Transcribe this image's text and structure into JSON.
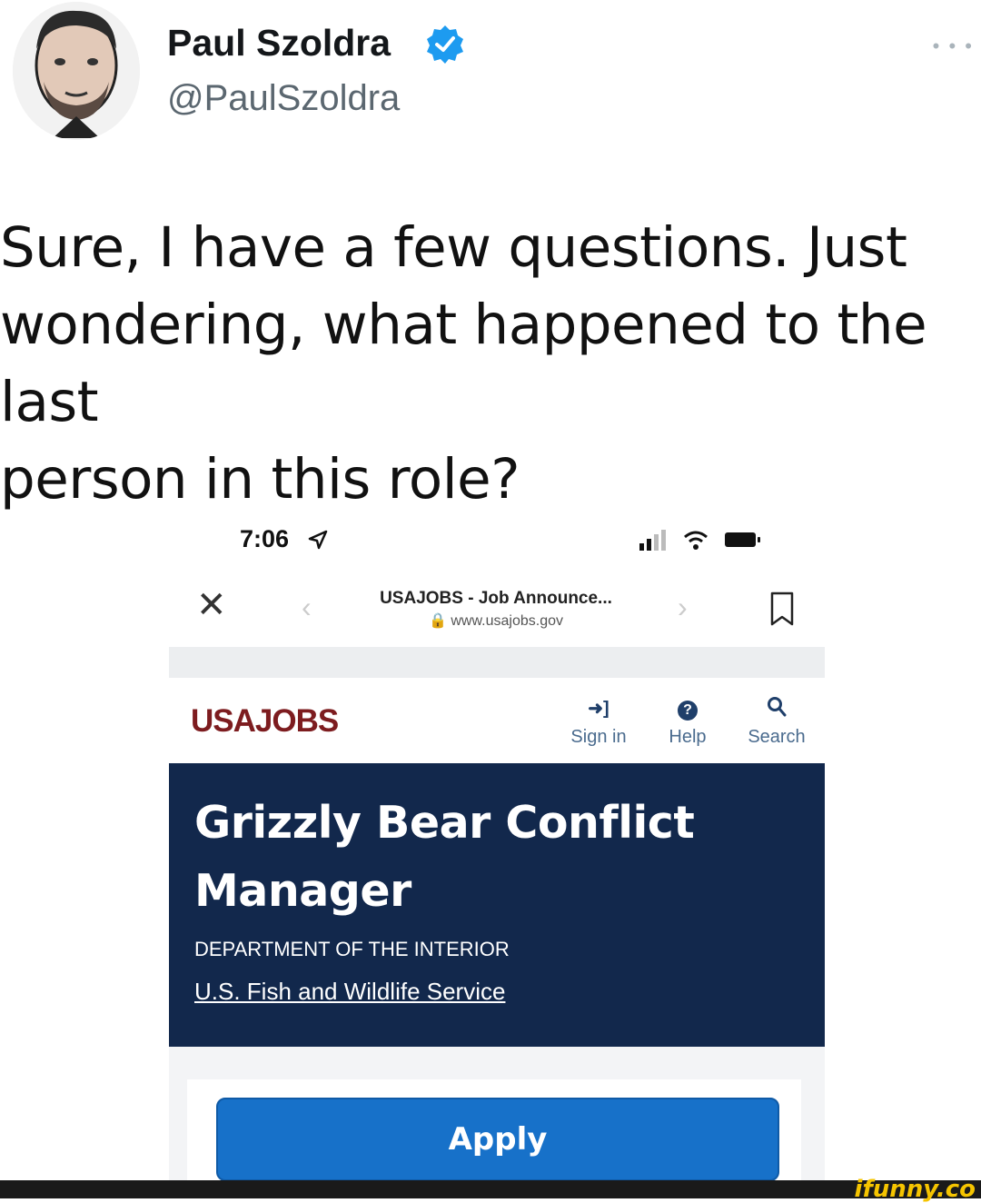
{
  "tweet": {
    "author_name": "Paul Szoldra",
    "handle": "@PaulSzoldra",
    "verified_icon": "verified-badge-icon",
    "more_icon": "more-options-icon",
    "text": "Sure, I have a few questions. Just\nwondering, what happened to the last\nperson in this role?"
  },
  "phone": {
    "status_time": "7:06",
    "location_icon": "location-arrow-icon",
    "status_icons": [
      "cellular-signal-icon",
      "wifi-icon",
      "battery-icon"
    ]
  },
  "browser": {
    "close_icon": "close-icon",
    "back_icon": "chevron-left-icon",
    "forward_icon": "chevron-right-icon",
    "page_title": "USAJOBS - Job Announce...",
    "url": "🔒 www.usajobs.gov",
    "bookmark_icon": "bookmark-icon"
  },
  "site": {
    "logo": "USAJOBS",
    "nav": [
      {
        "icon": "➜]",
        "label": "Sign in"
      },
      {
        "icon": "?",
        "label": "Help"
      },
      {
        "icon": "⚲",
        "label": "Search"
      }
    ]
  },
  "job": {
    "title": "Grizzly Bear Conflict Manager",
    "agency": "DEPARTMENT OF THE INTERIOR",
    "subagency": "U.S. Fish and Wildlife Service",
    "apply_label": "Apply"
  },
  "colors": {
    "hero_bg": "#12284c",
    "logo": "#7d1c1f",
    "apply_button": "#1771c9",
    "verified": "#1d9bf0"
  },
  "watermark": "ifunny.co"
}
